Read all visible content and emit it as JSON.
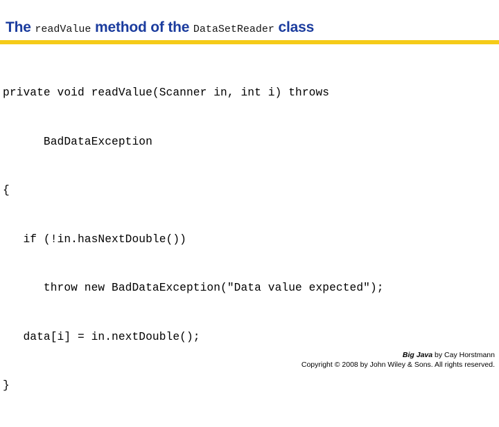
{
  "slide": {
    "title": {
      "segments": [
        {
          "text": "The ",
          "style": "blue"
        },
        {
          "text": "readValue",
          "style": "mono"
        },
        {
          "text": " method of the ",
          "style": "blue"
        },
        {
          "text": "DataSetReader",
          "style": "mono"
        },
        {
          "text": " class",
          "style": "blue"
        }
      ],
      "plain": "The readValue method of the DataSetReader class"
    },
    "rule_color": "#F5CB19",
    "title_color": "#1B3C9E",
    "code": {
      "lines": [
        "private void readValue(Scanner in, int i) throws",
        "      BadDataException",
        "{",
        "   if (!in.hasNextDouble())",
        "      throw new BadDataException(\"Data value expected\");",
        "   data[i] = in.nextDouble();",
        "}"
      ]
    },
    "footer": {
      "book_title": "Big Java",
      "author_credit": " by Cay Horstmann",
      "copyright": "Copyright © 2008 by John Wiley & Sons.  All rights reserved."
    }
  }
}
